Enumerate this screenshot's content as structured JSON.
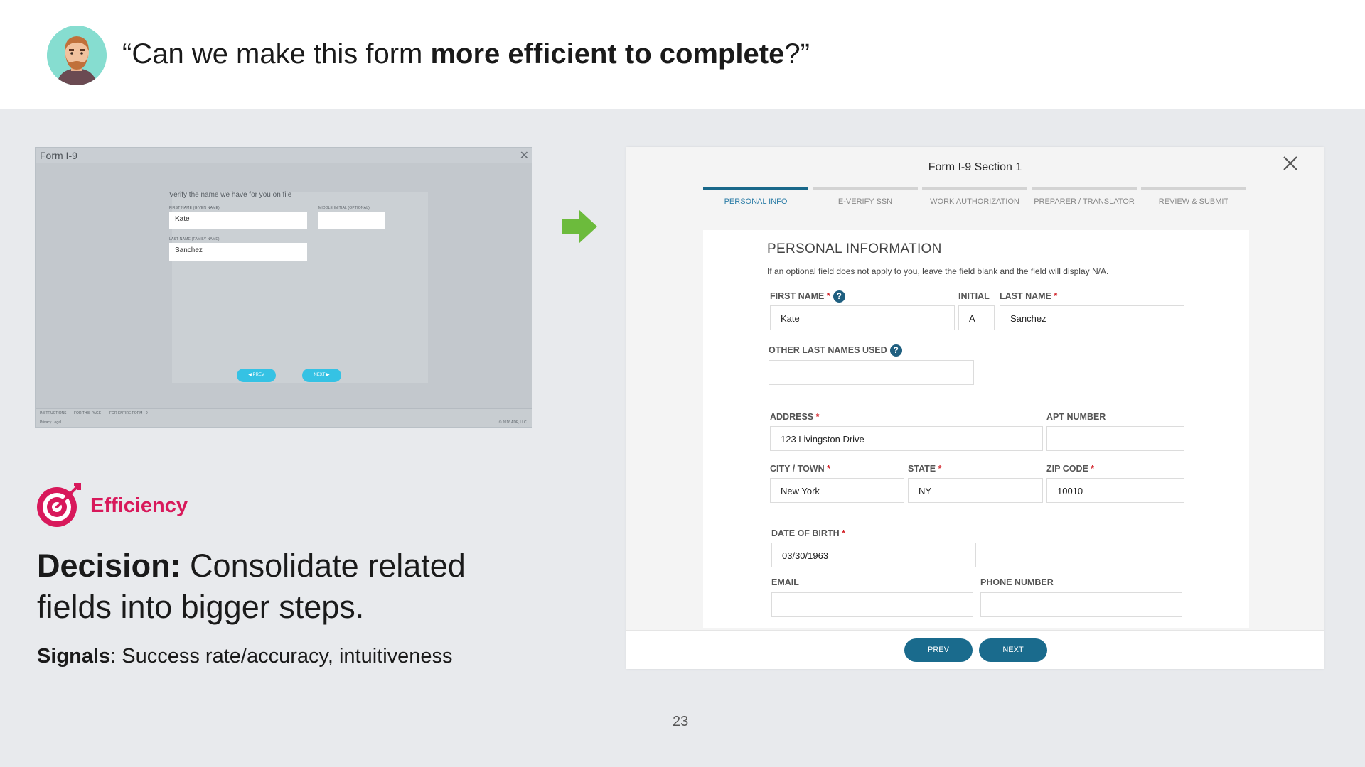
{
  "header": {
    "quote_open": "“Can we make this form ",
    "quote_bold": "more efficient to complete",
    "quote_close": "?”"
  },
  "old_form": {
    "title": "Form I-9",
    "close": "✕",
    "heading": "Verify the name we have for you on file",
    "first_name_label": "FIRST NAME (GIVEN NAME)",
    "middle_initial_label": "MIDDLE INITIAL (OPTIONAL)",
    "last_name_label": "LAST NAME (FAMILY NAME)",
    "first_name_value": "Kate",
    "last_name_value": "Sanchez",
    "prev": "◀ PREV",
    "next": "NEXT ▶",
    "footer_instructions": "INSTRUCTIONS",
    "footer_this_page": "FOR THIS PAGE",
    "footer_entire_form": "FOR ENTIRE FORM I-9",
    "footer_privacy": "Privacy   Legal",
    "footer_copyright": "© 2016 ADP, LLC."
  },
  "efficiency": {
    "label": "Efficiency",
    "icon": "target-icon",
    "color": "#d8195b"
  },
  "decision": {
    "bold": "Decision:",
    "text": " Consolidate related fields into bigger steps."
  },
  "signals": {
    "bold": "Signals",
    "text": ": Success rate/accuracy, intuitiveness"
  },
  "page_number": "23",
  "new_form": {
    "title": "Form I-9 Section 1",
    "steps": [
      {
        "label": "PERSONAL INFO",
        "active": true
      },
      {
        "label": "E-VERIFY SSN",
        "active": false
      },
      {
        "label": "WORK AUTHORIZATION",
        "active": false
      },
      {
        "label": "PREPARER / TRANSLATOR",
        "active": false
      },
      {
        "label": "REVIEW & SUBMIT",
        "active": false
      }
    ],
    "section_title": "PERSONAL INFORMATION",
    "hint": "If an optional field does not apply to you, leave the field blank and the field will display N/A.",
    "fields": {
      "first_name": {
        "label": "FIRST NAME",
        "value": "Kate"
      },
      "initial": {
        "label": "INITIAL",
        "value": "A"
      },
      "last_name": {
        "label": "LAST NAME",
        "value": "Sanchez"
      },
      "other_last_names": {
        "label": "OTHER LAST NAMES USED",
        "value": ""
      },
      "address": {
        "label": "ADDRESS",
        "value": "123 Livingston Drive"
      },
      "apt_number": {
        "label": "APT NUMBER",
        "value": ""
      },
      "city": {
        "label": "CITY / TOWN",
        "value": "New York"
      },
      "state": {
        "label": "STATE",
        "value": "NY"
      },
      "zip": {
        "label": "ZIP CODE",
        "value": "10010"
      },
      "dob": {
        "label": "DATE OF BIRTH",
        "value": "03/30/1963"
      },
      "email": {
        "label": "EMAIL",
        "value": ""
      },
      "phone": {
        "label": "PHONE NUMBER",
        "value": ""
      }
    },
    "required_mark": "*",
    "help_glyph": "?",
    "prev": "PREV",
    "next": "NEXT",
    "accent": "#1a6b8d"
  }
}
